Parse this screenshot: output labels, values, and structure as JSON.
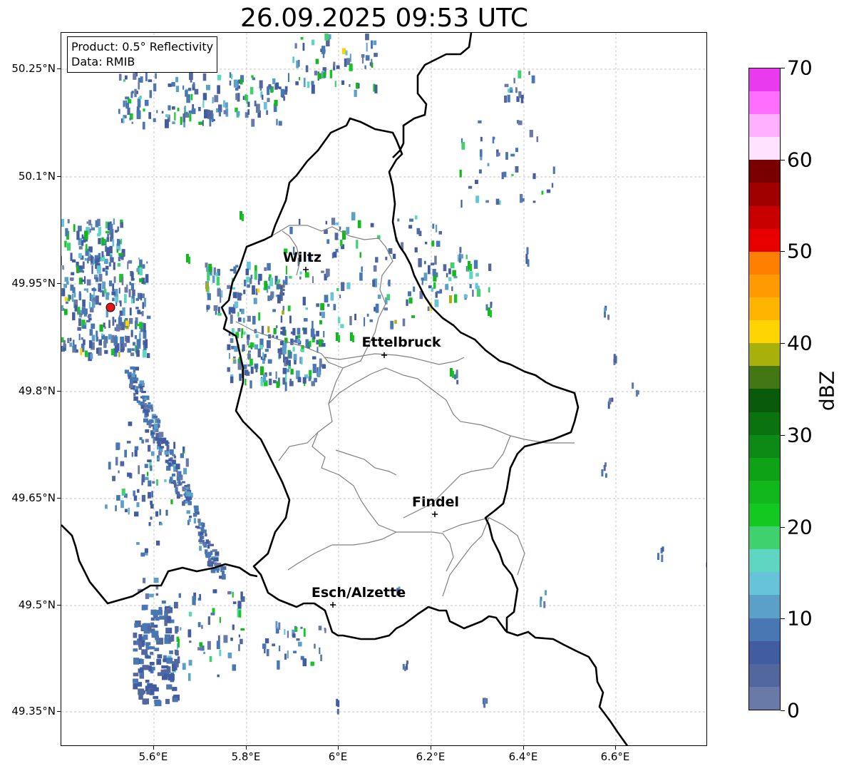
{
  "title": "26.09.2025 09:53 UTC",
  "info": {
    "product": "Product: 0.5° Reflectivity",
    "source": "Data: RMIB"
  },
  "map": {
    "lat_ticks": [
      "50.25°N",
      "50.1°N",
      "49.95°N",
      "49.8°N",
      "49.65°N",
      "49.5°N",
      "49.35°N"
    ],
    "lon_ticks": [
      "5.6°E",
      "5.8°E",
      "6°E",
      "6.2°E",
      "6.4°E",
      "6.6°E"
    ],
    "cities": [
      {
        "name": "Wiltz"
      },
      {
        "name": "Ettelbruck"
      },
      {
        "name": "Findel"
      },
      {
        "name": "Esch/Alzette"
      }
    ],
    "radar_marker_color": "#e8141a",
    "border_color": "#000000",
    "canton_color": "#808080",
    "grid": true
  },
  "colorbar": {
    "unit": "dBZ",
    "range": [
      0,
      70
    ],
    "tick_labels": [
      "0",
      "10",
      "20",
      "30",
      "40",
      "50",
      "60",
      "70"
    ],
    "colors": [
      "#6a7aa8",
      "#52679e",
      "#415ca0",
      "#4877b3",
      "#5aa0c8",
      "#66c3da",
      "#5fd6c2",
      "#3fd16e",
      "#14c822",
      "#12b81b",
      "#0ea317",
      "#0d8a16",
      "#0a7310",
      "#0a5a0c",
      "#427714",
      "#a8b10c",
      "#ffd400",
      "#ffb400",
      "#ff9b00",
      "#ff8000",
      "#e80000",
      "#c80000",
      "#a00000",
      "#780000",
      "#ffe2ff",
      "#ffb1ff",
      "#ff6eff",
      "#e93af0"
    ]
  }
}
